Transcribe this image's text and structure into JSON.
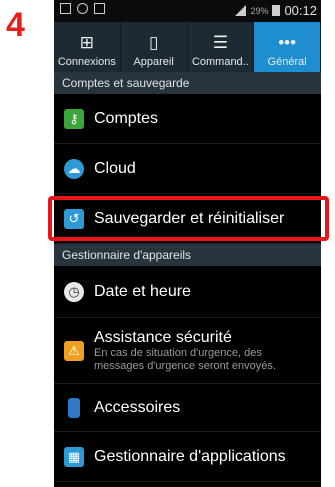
{
  "step_number": "4",
  "status_bar": {
    "battery_percent": "29%",
    "time": "00:12"
  },
  "tabs": [
    {
      "label": "Connexions",
      "icon": "connections-icon",
      "active": false
    },
    {
      "label": "Appareil",
      "icon": "device-icon",
      "active": false
    },
    {
      "label": "Command..",
      "icon": "controls-icon",
      "active": false
    },
    {
      "label": "Général",
      "icon": "more-dots-icon",
      "active": true
    }
  ],
  "sections": [
    {
      "header": "Comptes et sauvegarde",
      "items": [
        {
          "label": "Comptes",
          "icon": "key-icon",
          "icon_color": "#3ea53b"
        },
        {
          "label": "Cloud",
          "icon": "cloud-icon",
          "icon_color": "#2d9ad6"
        },
        {
          "label": "Sauvegarder et réinitialiser",
          "icon": "backup-reset-icon",
          "icon_color": "#2d9ad6",
          "highlighted": true
        }
      ]
    },
    {
      "header": "Gestionnaire d'appareils",
      "items": [
        {
          "label": "Date et heure",
          "icon": "clock-icon",
          "icon_color": "#e8e8e8"
        },
        {
          "label": "Assistance sécurité",
          "sub": "En cas de situation d'urgence, des messages d'urgence seront envoyés.",
          "icon": "safety-alert-icon",
          "icon_color": "#f0a020"
        },
        {
          "label": "Accessoires",
          "icon": "accessory-icon",
          "icon_color": "#2d78c8"
        },
        {
          "label": "Gestionnaire d'applications",
          "icon": "app-manager-icon",
          "icon_color": "#2d9ad6"
        }
      ]
    }
  ],
  "colors": {
    "highlight": "#e8151b",
    "active_tab": "#1e8ed0",
    "step_number": "#e4221c"
  }
}
